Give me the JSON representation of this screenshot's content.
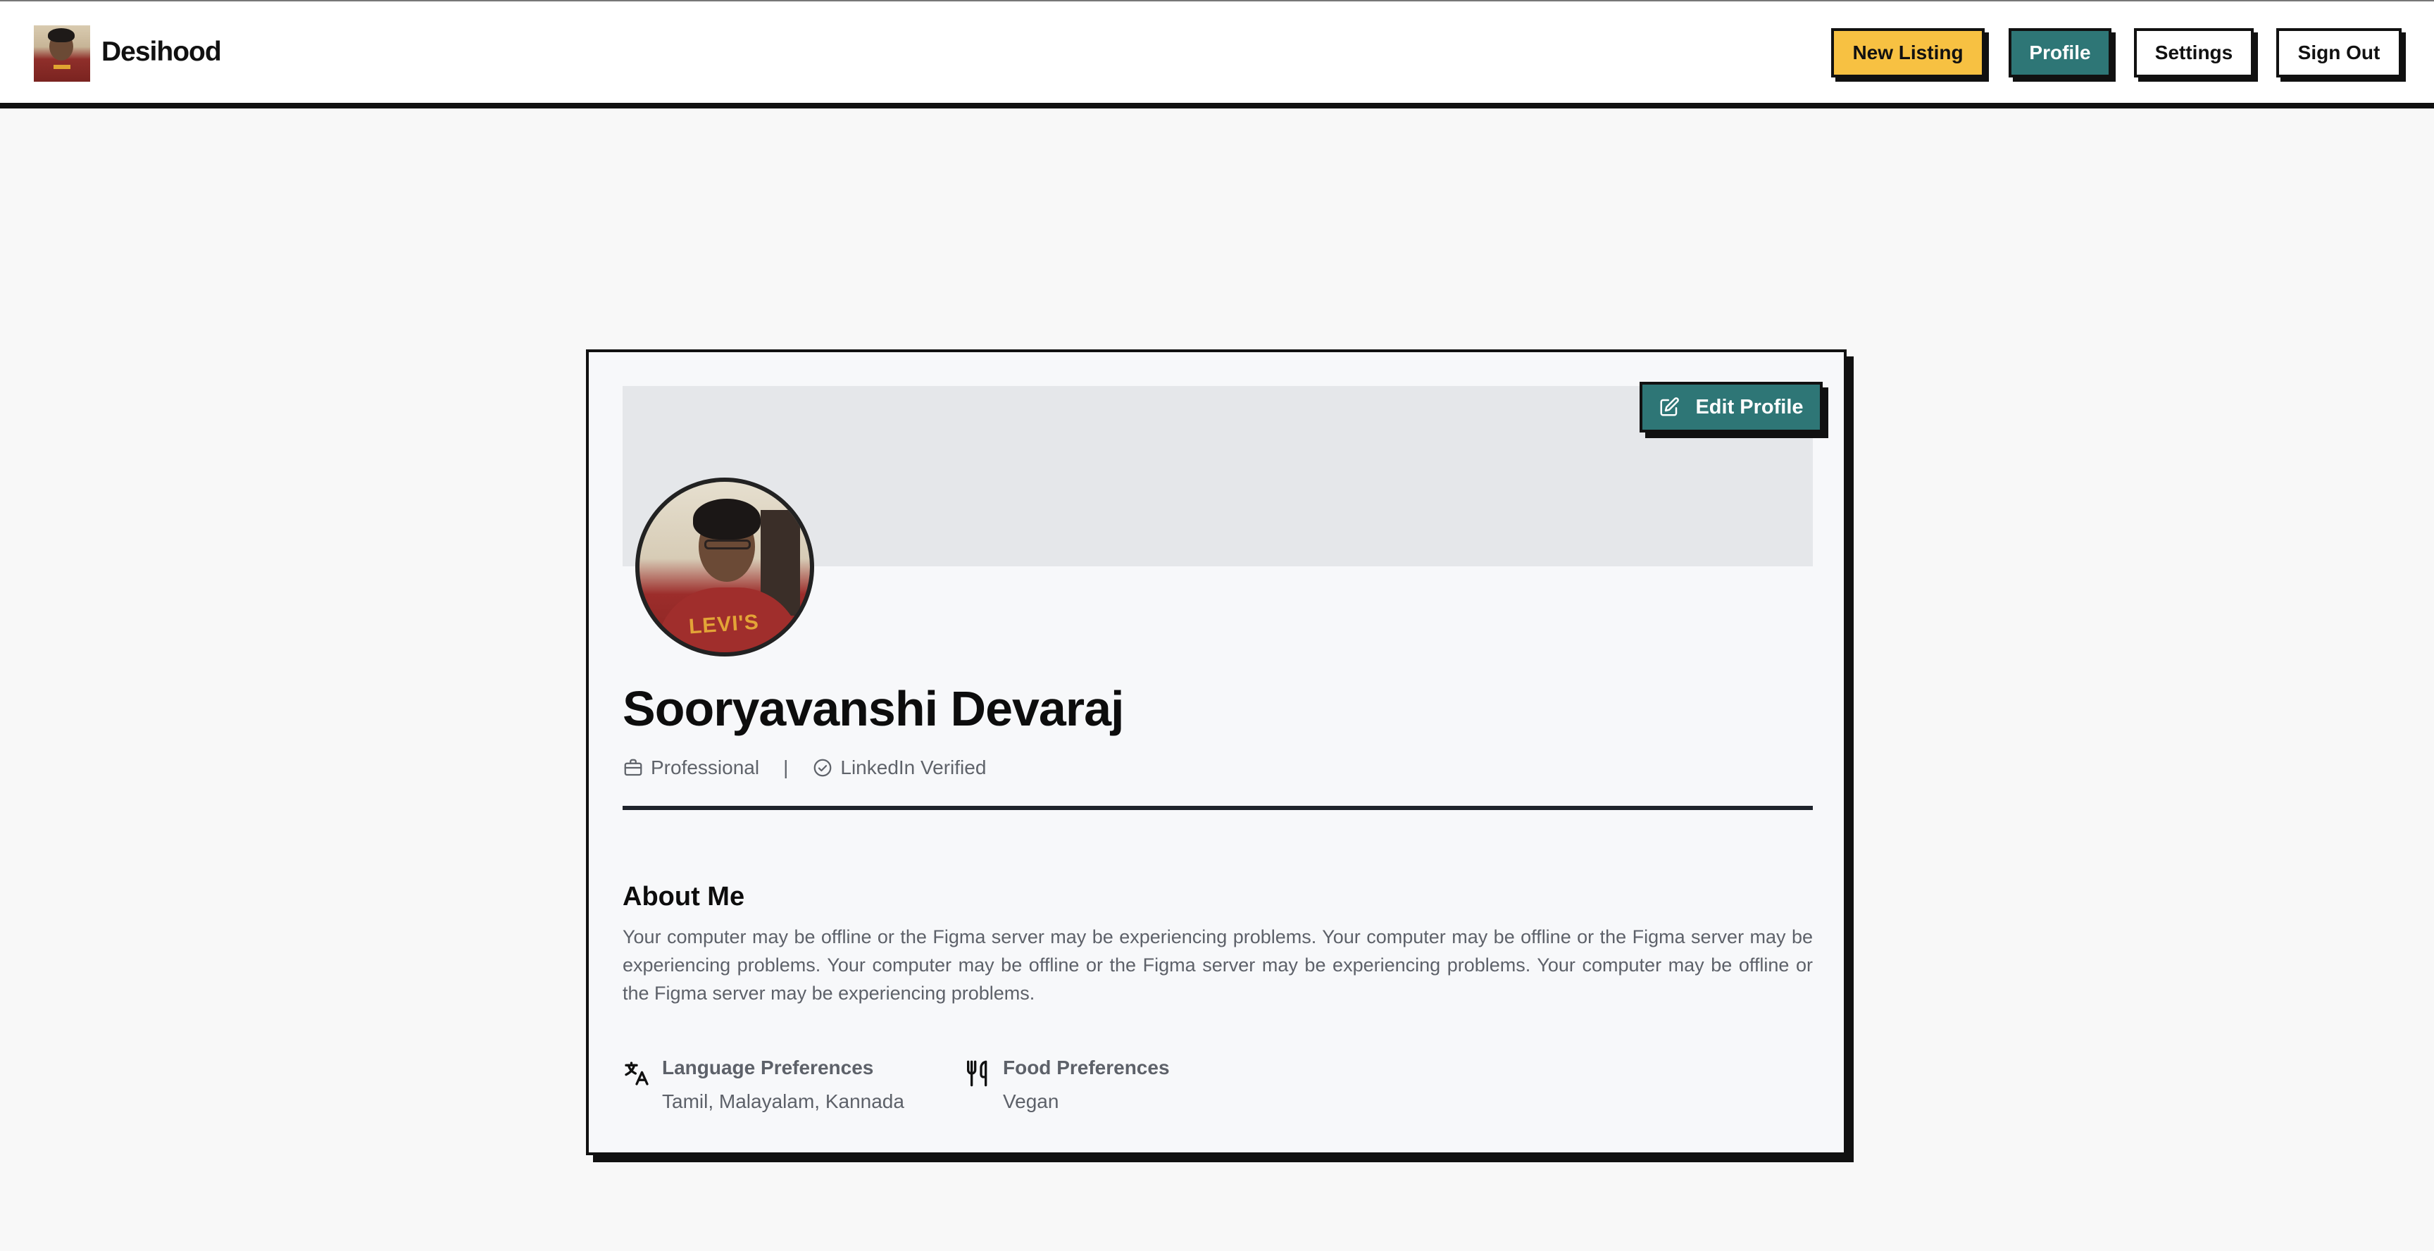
{
  "app": {
    "brand_name": "Desihood"
  },
  "nav": {
    "new_listing": "New Listing",
    "profile": "Profile",
    "settings": "Settings",
    "sign_out": "Sign Out"
  },
  "profile": {
    "edit_button": "Edit Profile",
    "name": "Sooryavanshi Devaraj",
    "role": "Professional",
    "separator": "|",
    "verification": "LinkedIn Verified",
    "shirt_print": "LEVI'S",
    "about_title": "About Me",
    "about_text": "Your computer may be offline or the Figma server may be experiencing problems. Your computer may be offline or the Figma server may be experiencing problems. Your computer may be offline or the Figma server may be experiencing problems. Your computer may be offline or the Figma server may be experiencing problems.",
    "preferences": [
      {
        "icon": "translate-icon",
        "label": "Language Preferences",
        "value": "Tamil, Malayalam, Kannada"
      },
      {
        "icon": "utensils-icon",
        "label": "Food Preferences",
        "value": "Vegan"
      }
    ]
  },
  "colors": {
    "accent_teal": "#2e7676",
    "accent_yellow": "#f7c142",
    "border_dark": "#111111",
    "page_bg": "#f8f8f8"
  }
}
